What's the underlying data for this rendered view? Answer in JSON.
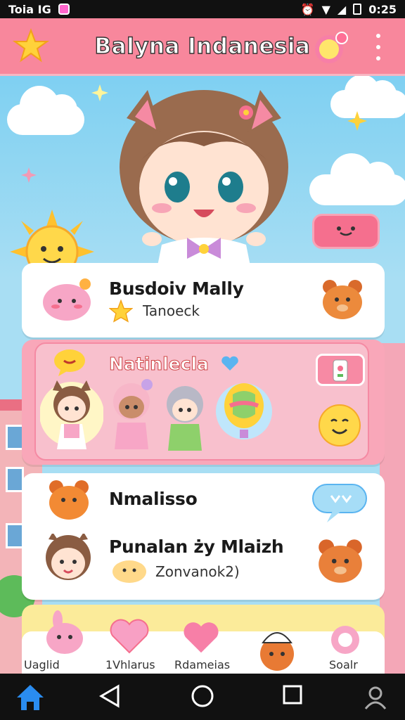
{
  "status_bar": {
    "carrier": "Toia IG",
    "time": "0:25"
  },
  "header": {
    "title": "Balyna Indanesia",
    "star_icon": "star-icon",
    "heart_icon": "heart-icon",
    "menu_icon": "kebab-menu-icon"
  },
  "cards": [
    {
      "title": "Busdoiv Mally",
      "subtitle": "Tanoeck"
    },
    {
      "title": "Natinlecla"
    },
    {
      "title": "Nmalisso"
    },
    {
      "title": "Punalan ży Mlaizh",
      "subtitle": "Zonvanok2)"
    }
  ],
  "bottom_tabs": [
    {
      "label": "Uaglid"
    },
    {
      "label": "1Vhlarus"
    },
    {
      "label": "Rdameias"
    },
    {
      "label": "Soalr"
    }
  ],
  "colors": {
    "header": "#f8879c",
    "sky": "#8fd3ef",
    "accent_pink": "#f56f8e",
    "card_yellow": "#fbeb9a"
  }
}
